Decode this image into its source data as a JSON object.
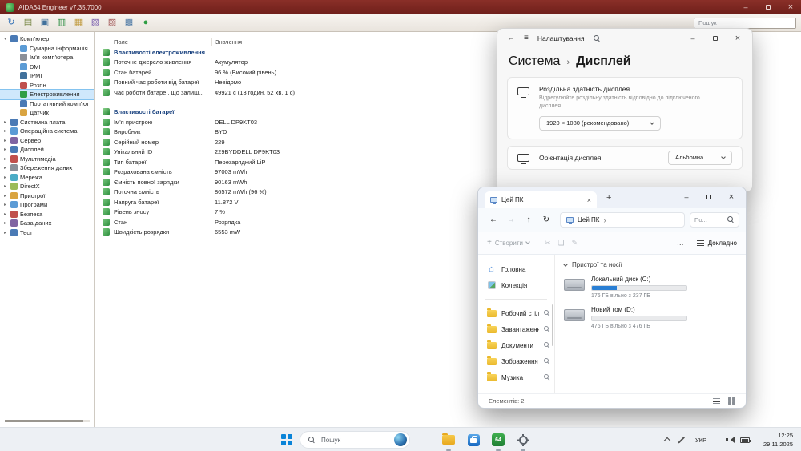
{
  "aida": {
    "window_title": "AIDA64 Engineer v7.35.7000",
    "search_placeholder": "Пошук",
    "toolbar_icons": [
      {
        "name": "back-icon",
        "glyph": "↻",
        "color": "#2e6db4"
      },
      {
        "name": "report-icon",
        "glyph": "▤",
        "color": "#6f7f3a"
      },
      {
        "name": "computer-icon",
        "glyph": "▣",
        "color": "#41719c"
      },
      {
        "name": "chart-icon",
        "glyph": "▥",
        "color": "#2f8f44"
      },
      {
        "name": "folder-icon",
        "glyph": "▦",
        "color": "#c09a3e"
      },
      {
        "name": "devices-icon",
        "glyph": "▧",
        "color": "#7a5fae"
      },
      {
        "name": "fdb-icon",
        "glyph": "▨",
        "color": "#a05555"
      },
      {
        "name": "database-icon",
        "glyph": "▩",
        "color": "#4f7aa5"
      },
      {
        "name": "aida-logo-icon",
        "glyph": "●",
        "color": "#2f9e44"
      }
    ],
    "columns": {
      "field": "Поле",
      "value": "Значення"
    },
    "tree": [
      {
        "label": "Комп'ютер",
        "level": 0,
        "expanded": true,
        "color": "#4a7ab5"
      },
      {
        "label": "Сумарна інформація",
        "level": 1,
        "color": "#5b9bd5"
      },
      {
        "label": "Ім'я комп'ютера",
        "level": 1,
        "color": "#8a8f98"
      },
      {
        "label": "DMI",
        "level": 1,
        "color": "#5b9bd5"
      },
      {
        "label": "IPMI",
        "level": 1,
        "color": "#41719c"
      },
      {
        "label": "Розгін",
        "level": 1,
        "color": "#c0504d"
      },
      {
        "label": "Електроживлення",
        "level": 1,
        "selected": true,
        "color": "#2f9e44"
      },
      {
        "label": "Портативний комп'ют",
        "level": 1,
        "color": "#4a7ab5"
      },
      {
        "label": "Датчик",
        "level": 1,
        "color": "#d9a441"
      },
      {
        "label": "Системна плата",
        "level": 0,
        "color": "#4a7ab5"
      },
      {
        "label": "Операційна система",
        "level": 0,
        "color": "#5b9bd5"
      },
      {
        "label": "Сервер",
        "level": 0,
        "color": "#8064a2"
      },
      {
        "label": "Дисплей",
        "level": 0,
        "color": "#4a7ab5"
      },
      {
        "label": "Мультимедіа",
        "level": 0,
        "color": "#c0504d"
      },
      {
        "label": "Збереження даних",
        "level": 0,
        "color": "#8a8f98"
      },
      {
        "label": "Мережа",
        "level": 0,
        "color": "#4bacc6"
      },
      {
        "label": "DirectX",
        "level": 0,
        "color": "#9bbb59"
      },
      {
        "label": "Пристрої",
        "level": 0,
        "color": "#d9a441"
      },
      {
        "label": "Програми",
        "level": 0,
        "color": "#5b9bd5"
      },
      {
        "label": "Безпека",
        "level": 0,
        "color": "#c0504d"
      },
      {
        "label": "База даних",
        "level": 0,
        "color": "#8064a2"
      },
      {
        "label": "Тест",
        "level": 0,
        "color": "#4a7ab5"
      }
    ],
    "rows": [
      {
        "type": "section",
        "field": "Властивості електроживлення"
      },
      {
        "type": "item",
        "field": "Поточне джерело живлення",
        "value": "Акумулятор"
      },
      {
        "type": "item",
        "field": "Стан батарей",
        "value": "96 % (Високий рівень)"
      },
      {
        "type": "item",
        "field": "Повний час роботи від батареї",
        "value": "Невідомо"
      },
      {
        "type": "item",
        "field": "Час роботи батареї, що залиш...",
        "value": "49921 с (13 годин, 52 хв, 1 с)"
      },
      {
        "type": "spacer"
      },
      {
        "type": "section",
        "field": "Властивості батареї"
      },
      {
        "type": "item",
        "field": "Ім'я пристрою",
        "value": "DELL DP9KT03"
      },
      {
        "type": "item",
        "field": "Виробник",
        "value": "BYD"
      },
      {
        "type": "item",
        "field": "Серійний номер",
        "value": "229"
      },
      {
        "type": "item",
        "field": "Унікальний ID",
        "value": "229BYDDELL DP9KT03"
      },
      {
        "type": "item",
        "field": "Тип батареї",
        "value": "Перезарядний LiP"
      },
      {
        "type": "item",
        "field": "Розрахована ємність",
        "value": "97003 mWh"
      },
      {
        "type": "item",
        "field": "Ємність повної зарядки",
        "value": "90163 mWh"
      },
      {
        "type": "item",
        "field": "Поточна ємність",
        "value": "86572 mWh  (96 %)"
      },
      {
        "type": "item",
        "field": "Напруга батареї",
        "value": "11.872 V"
      },
      {
        "type": "item",
        "field": "Рівень зносу",
        "value": "7 %"
      },
      {
        "type": "item",
        "field": "Стан",
        "value": "Розрядка"
      },
      {
        "type": "item",
        "field": "Швидкість розрядки",
        "value": "6553 mW"
      }
    ]
  },
  "settings": {
    "title": "Налаштування",
    "breadcrumb": [
      "Система",
      "Дисплей"
    ],
    "cards": [
      {
        "title": "Роздільна здатність дисплея",
        "subtitle": "Відрегулюйте роздільну здатність відповідно до підключеного дисплея",
        "value": "1920 × 1080 (рекомендовано)"
      },
      {
        "title": "Орієнтація дисплея",
        "value": "Альбомна"
      }
    ]
  },
  "explorer": {
    "tab_title": "Цей ПК",
    "address": "Цей ПК",
    "search_placeholder": "По...",
    "new_button": "Створити",
    "more_button": "…",
    "details_button": "Докладно",
    "disabled_icons": [
      {
        "name": "cut-icon",
        "glyph": "✂"
      },
      {
        "name": "copy-icon",
        "glyph": "❏"
      },
      {
        "name": "rename-icon",
        "glyph": "✎"
      }
    ],
    "sidebar": [
      {
        "label": "Головна",
        "icon": "home-icon",
        "style": "home"
      },
      {
        "label": "Колекція",
        "icon": "gallery-icon",
        "style": "gallery",
        "separator_after": true
      },
      {
        "label": "Робочий стіл",
        "icon": "desktop-folder-icon",
        "style": "folder",
        "pinned": true
      },
      {
        "label": "Завантаження",
        "icon": "downloads-folder-icon",
        "style": "folder",
        "pinned": true
      },
      {
        "label": "Документи",
        "icon": "documents-folder-icon",
        "style": "folder",
        "pinned": true
      },
      {
        "label": "Зображення",
        "icon": "pictures-folder-icon",
        "style": "folder",
        "pinned": true
      },
      {
        "label": "Музика",
        "icon": "music-folder-icon",
        "style": "folder",
        "pinned": true
      }
    ],
    "group_header": "Пристрої та носії",
    "drives": [
      {
        "name": "Локальний диск (C:)",
        "caption": "176 ГБ вільно з 237 ГБ",
        "used_percent": 26
      },
      {
        "name": "Новий том (D:)",
        "caption": "476 ГБ вільно з 476 ГБ",
        "used_percent": 0
      }
    ],
    "status": "Елементів: 2"
  },
  "taskbar": {
    "search_placeholder": "Пошук",
    "language": "УКР",
    "time": "12:25",
    "date": "29.11.2025",
    "apps": [
      {
        "name": "taskbar-file-explorer-button",
        "icon": "explorer",
        "running": true
      },
      {
        "name": "taskbar-store-button",
        "icon": "store",
        "running": false
      },
      {
        "name": "taskbar-aida64-button",
        "icon": "aida",
        "label": "64",
        "running": true
      },
      {
        "name": "taskbar-settings-button",
        "icon": "gear",
        "running": true
      }
    ]
  }
}
